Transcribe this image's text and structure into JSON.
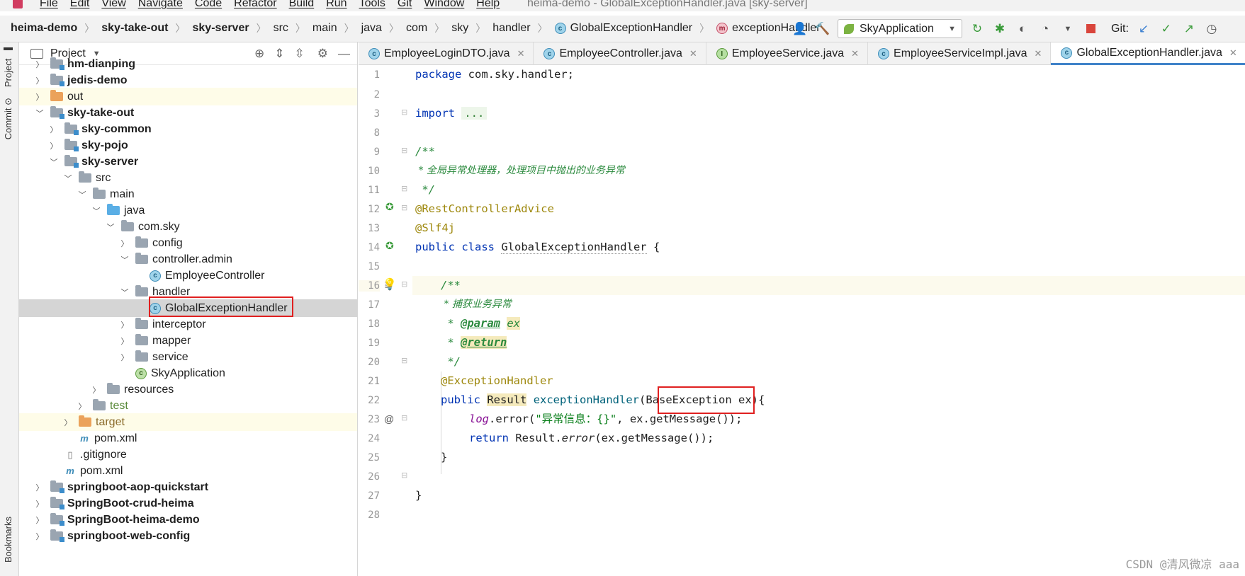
{
  "menu": {
    "items": [
      "File",
      "Edit",
      "View",
      "Navigate",
      "Code",
      "Refactor",
      "Build",
      "Run",
      "Tools",
      "Git",
      "Window",
      "Help"
    ],
    "window_title": "heima-demo - GlobalExceptionHandler.java [sky-server]"
  },
  "breadcrumbs": [
    "heima-demo",
    "sky-take-out",
    "sky-server",
    "src",
    "main",
    "java",
    "com",
    "sky",
    "handler",
    "GlobalExceptionHandler",
    "exceptionHandler"
  ],
  "run_config": "SkyApplication",
  "git_label": "Git:",
  "left_strip": {
    "project": "Project",
    "commit": "Commit",
    "bookmarks": "Bookmarks"
  },
  "project_panel": {
    "title": "Project"
  },
  "tree": [
    {
      "label": "hm-dianping",
      "bold": true
    },
    {
      "label": "jedis-demo",
      "bold": true
    },
    {
      "label": "out"
    },
    {
      "label": "sky-take-out",
      "bold": true
    },
    {
      "label": "sky-common",
      "bold": true
    },
    {
      "label": "sky-pojo",
      "bold": true
    },
    {
      "label": "sky-server",
      "bold": true
    },
    {
      "label": "src"
    },
    {
      "label": "main"
    },
    {
      "label": "java"
    },
    {
      "label": "com.sky"
    },
    {
      "label": "config"
    },
    {
      "label": "controller.admin"
    },
    {
      "label": "EmployeeController"
    },
    {
      "label": "handler"
    },
    {
      "label": "GlobalExceptionHandler"
    },
    {
      "label": "interceptor"
    },
    {
      "label": "mapper"
    },
    {
      "label": "service"
    },
    {
      "label": "SkyApplication"
    },
    {
      "label": "resources"
    },
    {
      "label": "test"
    },
    {
      "label": "target"
    },
    {
      "label": "pom.xml"
    },
    {
      "label": ".gitignore"
    },
    {
      "label": "pom.xml"
    },
    {
      "label": "springboot-aop-quickstart",
      "bold": true
    },
    {
      "label": "SpringBoot-crud-heima",
      "bold": true
    },
    {
      "label": "SpringBoot-heima-demo",
      "bold": true
    },
    {
      "label": "springboot-web-config",
      "bold": true
    }
  ],
  "editor_tabs": [
    {
      "label": "EmployeeLoginDTO.java",
      "icon": "class"
    },
    {
      "label": "EmployeeController.java",
      "icon": "class"
    },
    {
      "label": "EmployeeService.java",
      "icon": "interface"
    },
    {
      "label": "EmployeeServiceImpl.java",
      "icon": "class"
    },
    {
      "label": "GlobalExceptionHandler.java",
      "icon": "class",
      "active": true
    }
  ],
  "line_numbers": [
    "1",
    "2",
    "3",
    "8",
    "9",
    "10",
    "11",
    "12",
    "13",
    "14",
    "15",
    "16",
    "17",
    "18",
    "19",
    "20",
    "21",
    "22",
    "23",
    "24",
    "25",
    "26",
    "27",
    "28"
  ],
  "code": {
    "l1_kw": "package",
    "l1_rest": " com.sky.handler;",
    "l3_kw": "import",
    "l3_fold": "...",
    "l9": "/**",
    "l10": " * 全局异常处理器，处理项目中抛出的业务异常",
    "l11": " */",
    "l12": "@RestControllerAdvice",
    "l13": "@Slf4j",
    "l14_kw": "public class",
    "l14_name": "GlobalExceptionHandler",
    "l14_brace": " {",
    "l16": "/**",
    "l17": " * 捕获业务异常",
    "l18_star": " * ",
    "l18_tag": "@param",
    "l18_p": "ex",
    "l19_star": " * ",
    "l19_tag": "@return",
    "l20": " */",
    "l21": "@ExceptionHandler",
    "l22_kw": "public",
    "l22_type": "Result",
    "l22_fn": "exceptionHandler",
    "l22_paren": "(",
    "l22_param_type": "BaseException",
    "l22_rest": " ex){",
    "l23_log": "log",
    "l23_call": ".error(",
    "l23_str": "\"异常信息：{}\"",
    "l23_rest": ", ex.getMessage());",
    "l24_kw": "return",
    "l24_a": " Result.",
    "l24_err": "error",
    "l24_rest": "(ex.getMessage());",
    "l25": "}",
    "l27": "}"
  },
  "watermark": "CSDN @清风微凉 aaa"
}
